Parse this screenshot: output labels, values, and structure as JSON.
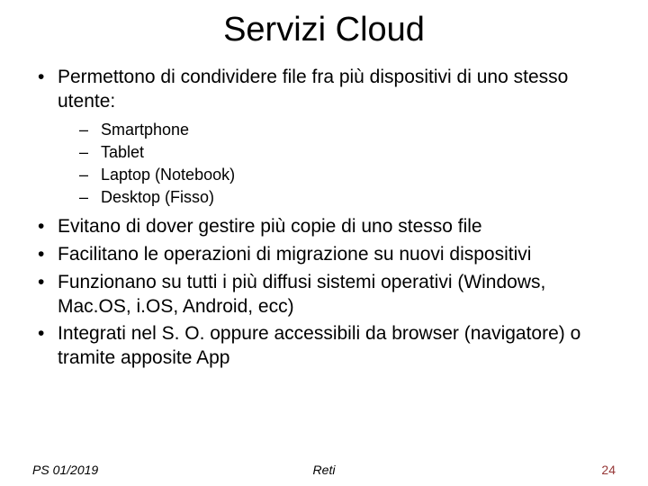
{
  "title": "Servizi Cloud",
  "bullets": {
    "b1": "Permettono di condividere file fra più dispositivi di uno stesso utente:",
    "sub": {
      "s1": "Smartphone",
      "s2": "Tablet",
      "s3": "Laptop (Notebook)",
      "s4": "Desktop (Fisso)"
    },
    "b2": "Evitano di dover gestire più copie di uno stesso file",
    "b3": "Facilitano le operazioni di migrazione su nuovi dispositivi",
    "b4": "Funzionano su tutti i più diffusi sistemi operativi (Windows, Mac.OS, i.OS, Android, ecc)",
    "b5": "Integrati nel S. O. oppure accessibili da browser (navigatore) o tramite apposite App"
  },
  "footer": {
    "left": "PS 01/2019",
    "center": "Reti",
    "right": "24"
  }
}
